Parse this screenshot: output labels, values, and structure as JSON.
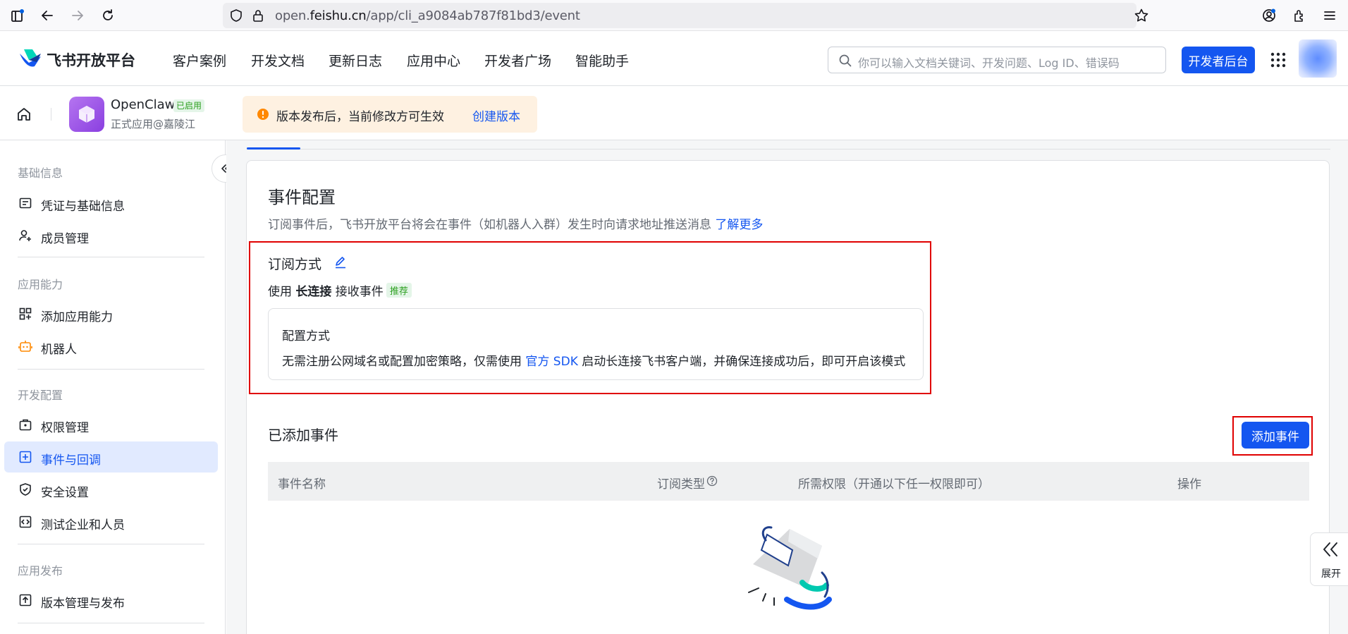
{
  "browser": {
    "url_prefix": "open.",
    "url_domain": "feishu.cn",
    "url_path": "/app/cli_a9084ab787f81bd3/event"
  },
  "topnav": {
    "logo": "飞书开放平台",
    "items": [
      "客户案例",
      "开发文档",
      "更新日志",
      "应用中心",
      "开发者广场",
      "智能助手"
    ],
    "search_placeholder": "你可以输入文档关键词、开发问题、Log ID、错误码",
    "dev_button": "开发者后台"
  },
  "app": {
    "name": "OpenClaw",
    "badge": "已启用",
    "subtitle": "正式应用@嘉陵江",
    "notice": "版本发布后，当前修改方可生效",
    "notice_link": "创建版本"
  },
  "sidebar": {
    "groups": [
      "基础信息",
      "应用能力",
      "开发配置",
      "应用发布"
    ],
    "items": [
      {
        "label": "凭证与基础信息",
        "icon": "credential-icon"
      },
      {
        "label": "成员管理",
        "icon": "member-icon"
      },
      {
        "label": "添加应用能力",
        "icon": "add-capability-icon"
      },
      {
        "label": "机器人",
        "icon": "robot-icon"
      },
      {
        "label": "权限管理",
        "icon": "permission-icon"
      },
      {
        "label": "事件与回调",
        "icon": "event-icon"
      },
      {
        "label": "安全设置",
        "icon": "shield-icon"
      },
      {
        "label": "测试企业和人员",
        "icon": "test-icon"
      },
      {
        "label": "版本管理与发布",
        "icon": "publish-icon"
      }
    ],
    "active": "事件与回调"
  },
  "main": {
    "title": "事件配置",
    "desc": "订阅事件后，飞书开放平台将会在事件（如机器人入群）发生时向请求地址推送消息 ",
    "desc_link": "了解更多",
    "sub_title": "订阅方式",
    "use_prefix": "使用 ",
    "use_bold": "长连接",
    "use_suffix": " 接收事件",
    "recommend_badge": "推荐",
    "cfg_title": "配置方式",
    "cfg_desc_prefix": "无需注册公网域名或配置加密策略，仅需使用 ",
    "cfg_desc_link": "官方 SDK",
    "cfg_desc_suffix": " 启动长连接飞书客户端，并确保连接成功后，即可开启该模式",
    "added_title": "已添加事件",
    "add_button": "添加事件",
    "columns": [
      "事件名称",
      "订阅类型",
      "所需权限（开通以下任一权限即可）",
      "操作"
    ],
    "expand_label": "展开"
  },
  "colors": {
    "primary": "#1456f0",
    "highlight_box": "#e00000",
    "success": "#2ea121",
    "notice_bg": "#fef1e1"
  }
}
